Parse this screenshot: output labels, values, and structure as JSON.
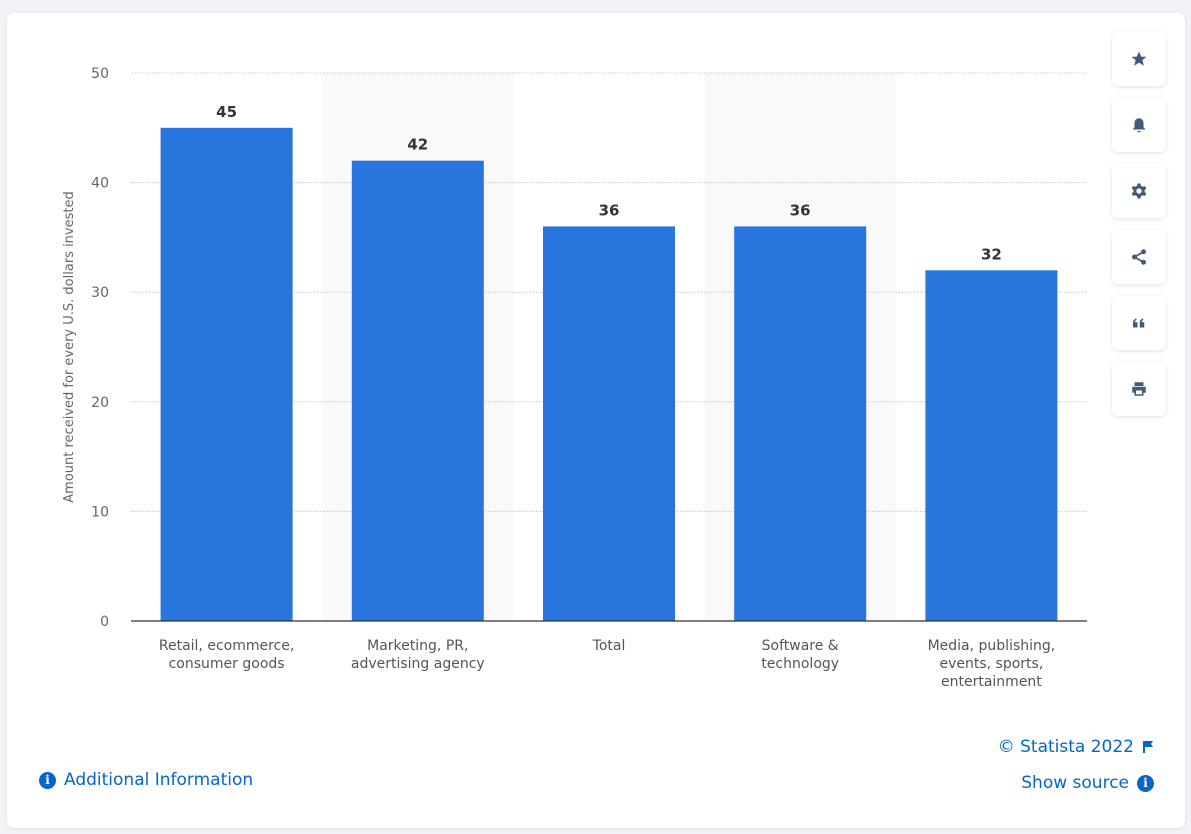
{
  "chart_data": {
    "type": "bar",
    "title": "",
    "xlabel": "",
    "ylabel": "Amount received for every U.S. dollars invested",
    "categories": [
      [
        "Retail, ecommerce,",
        "consumer goods"
      ],
      [
        "Marketing, PR,",
        "advertising agency"
      ],
      [
        "Total"
      ],
      [
        "Software &",
        "technology"
      ],
      [
        "Media, publishing,",
        "events, sports,",
        "entertainment"
      ]
    ],
    "values": [
      45,
      42,
      36,
      36,
      32
    ],
    "data_labels": [
      "45",
      "42",
      "36",
      "36",
      "32"
    ],
    "ylim": [
      0,
      50
    ],
    "yticks": [
      0,
      10,
      20,
      30,
      40,
      50
    ],
    "grid": true,
    "bar_color": "#2876dd"
  },
  "tools": [
    {
      "name": "favorite",
      "icon": "star-icon"
    },
    {
      "name": "notification",
      "icon": "bell-icon"
    },
    {
      "name": "settings",
      "icon": "gear-icon"
    },
    {
      "name": "share",
      "icon": "share-icon"
    },
    {
      "name": "cite",
      "icon": "quote-icon"
    },
    {
      "name": "print",
      "icon": "print-icon"
    }
  ],
  "footer": {
    "additional_info": "Additional Information",
    "copyright": "© Statista 2022",
    "show_source": "Show source",
    "info_glyph": "i"
  }
}
